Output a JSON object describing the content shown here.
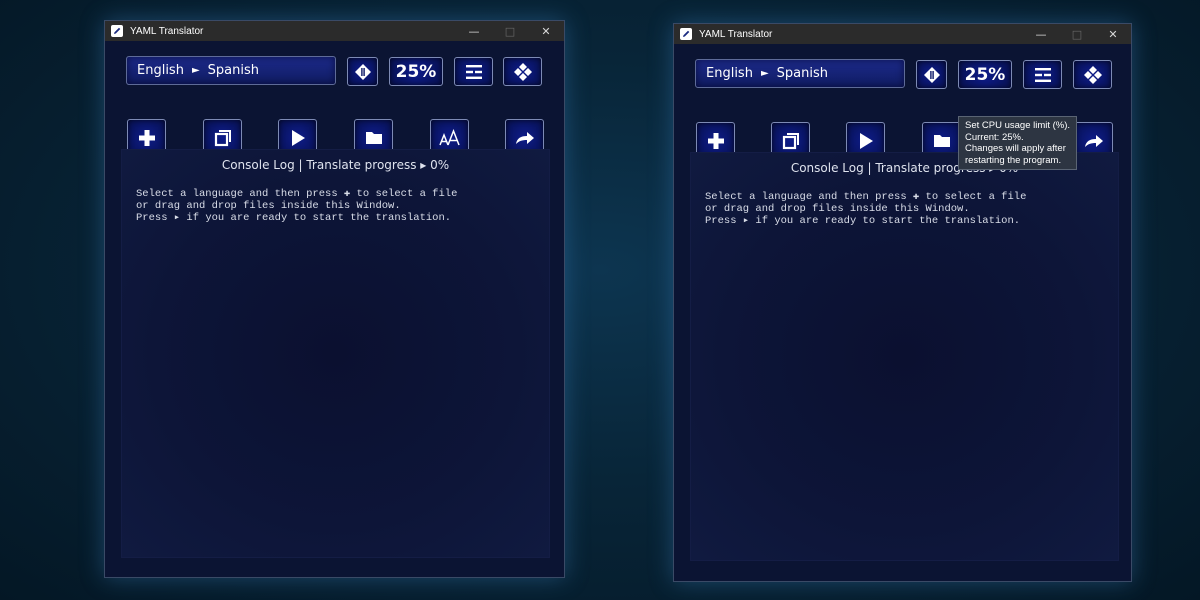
{
  "windows": [
    {
      "title": "YAML Translator",
      "controls": {
        "minimize": "—",
        "maximize": "□",
        "close": "✕"
      },
      "language": {
        "source": "English",
        "arrow": "►",
        "target": "Spanish"
      },
      "cpu_limit": "25%",
      "log": {
        "title": "Console Log | Translate progress ▸ 0%",
        "lines": [
          "Select a language and then press ✚ to select a file",
          "or drag and drop files inside this Window.",
          "Press ▸ if you are ready to start the translation."
        ]
      }
    },
    {
      "title": "YAML Translator",
      "controls": {
        "minimize": "—",
        "maximize": "□",
        "close": "✕"
      },
      "language": {
        "source": "English",
        "arrow": "►",
        "target": "Spanish"
      },
      "cpu_limit": "25%",
      "tooltip": {
        "lines": [
          "Set CPU usage limit (%).",
          "Current: 25%.",
          "Changes will apply after",
          "restarting the program."
        ]
      },
      "log": {
        "title": "Console Log | Translate progress ▸ 0%",
        "lines": [
          "Select a language and then press ✚ to select a file",
          "or drag and drop files inside this Window.",
          "Press ▸ if you are ready to start the translation."
        ]
      }
    }
  ],
  "icons": {
    "app": "pencil-icon",
    "toolbar_top": [
      "gear-icon",
      "cpu-limit",
      "menu-lines-icon",
      "diamond-grid-icon"
    ],
    "toolbar_bottom": [
      "plus-icon",
      "copy-icon",
      "play-icon",
      "folder-icon",
      "font-size-icon",
      "share-arrow-icon"
    ]
  },
  "colors": {
    "window_bg": "#0b1433",
    "button_bg": "#0e1c8a",
    "titlebar_bg": "#2b2b2b",
    "text": "#ffffff"
  }
}
